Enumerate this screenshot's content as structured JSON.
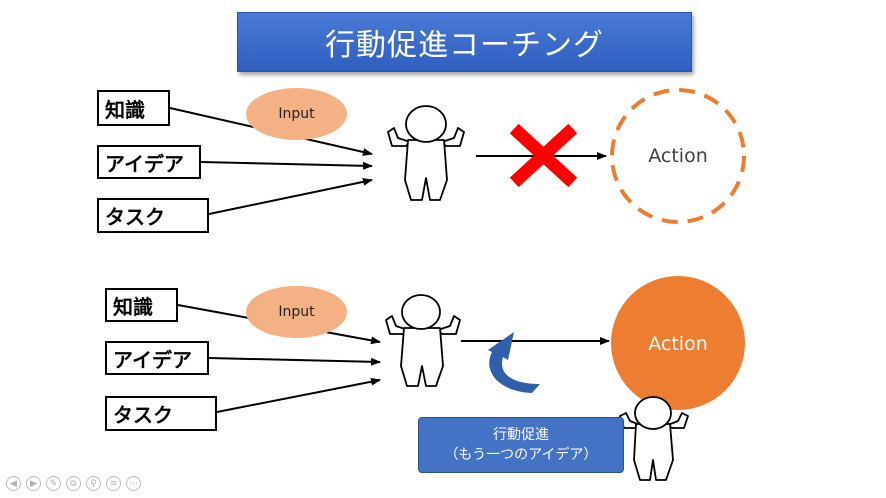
{
  "title": "行動促進コーチング",
  "top": {
    "labels": [
      "知識",
      "アイデア",
      "タスク"
    ],
    "input_label": "Input",
    "action_label": "Action"
  },
  "bottom": {
    "labels": [
      "知識",
      "アイデア",
      "タスク"
    ],
    "input_label": "Input",
    "action_label": "Action",
    "prompt_line1": "行動促進",
    "prompt_line2": "（もう一つのアイデア）"
  },
  "colors": {
    "title_bg": "#4472c4",
    "input_oval": "#f4b183",
    "action_orange": "#ed7d31",
    "cross_red": "#ff0000",
    "prompt_box": "#4472c4",
    "curved_arrow": "#2e5fa8"
  },
  "toolbar_icons": [
    "prev-icon",
    "next-icon",
    "pen-icon",
    "copy-icon",
    "zoom-icon",
    "menu-icon",
    "more-icon"
  ]
}
